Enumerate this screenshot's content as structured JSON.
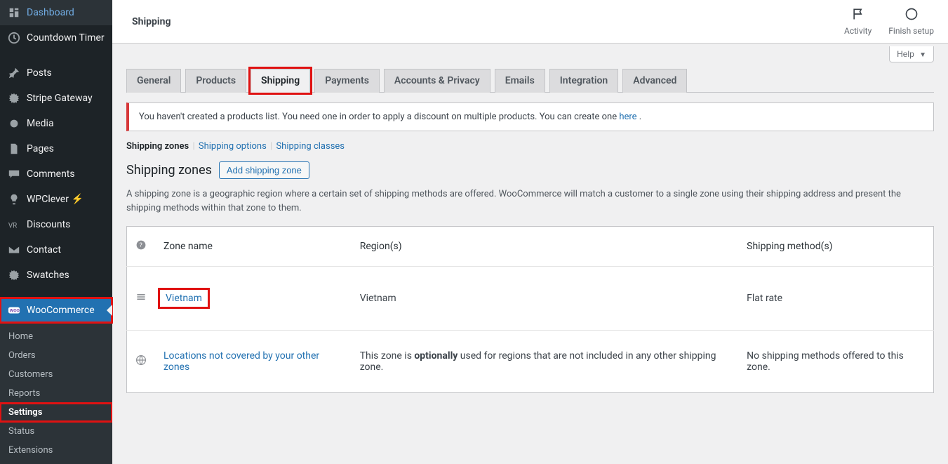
{
  "sidebar": {
    "items": [
      {
        "label": "Dashboard",
        "icon": "dashboard-icon"
      },
      {
        "label": "Countdown Timer",
        "icon": "clock-icon"
      },
      {
        "label": "Posts",
        "icon": "pin-icon"
      },
      {
        "label": "Stripe Gateway",
        "icon": "gear-icon"
      },
      {
        "label": "Media",
        "icon": "media-icon"
      },
      {
        "label": "Pages",
        "icon": "pages-icon"
      },
      {
        "label": "Comments",
        "icon": "comment-icon"
      },
      {
        "label": "WPClever ⚡",
        "icon": "bulb-icon"
      },
      {
        "label": "Discounts",
        "icon": "discount-icon"
      },
      {
        "label": "Contact",
        "icon": "mail-icon"
      },
      {
        "label": "Swatches",
        "icon": "gear-icon"
      },
      {
        "label": "WooCommerce",
        "icon": "woo-icon"
      }
    ],
    "submenu": [
      {
        "label": "Home"
      },
      {
        "label": "Orders"
      },
      {
        "label": "Customers"
      },
      {
        "label": "Reports"
      },
      {
        "label": "Settings",
        "active": true
      },
      {
        "label": "Status"
      },
      {
        "label": "Extensions"
      }
    ]
  },
  "topbar": {
    "title": "Shipping",
    "activity": "Activity",
    "finish_setup": "Finish setup"
  },
  "help_label": "Help",
  "tabs": [
    {
      "label": "General"
    },
    {
      "label": "Products"
    },
    {
      "label": "Shipping",
      "active": true,
      "highlighted": true
    },
    {
      "label": "Payments"
    },
    {
      "label": "Accounts & Privacy"
    },
    {
      "label": "Emails"
    },
    {
      "label": "Integration"
    },
    {
      "label": "Advanced"
    }
  ],
  "notice": {
    "text_before": "You haven't created a products list. You need one in order to apply a discount on multiple products. You can create one ",
    "link_text": "here",
    "text_after": " ."
  },
  "subnav": {
    "current": "Shipping zones",
    "options": "Shipping options",
    "classes": "Shipping classes"
  },
  "heading": "Shipping zones",
  "add_zone_label": "Add shipping zone",
  "description": "A shipping zone is a geographic region where a certain set of shipping methods are offered. WooCommerce will match a customer to a single zone using their shipping address and present the shipping methods within that zone to them.",
  "table": {
    "headers": {
      "zone": "Zone name",
      "region": "Region(s)",
      "method": "Shipping method(s)"
    },
    "rows": [
      {
        "zone": "Vietnam",
        "region": "Vietnam",
        "method": "Flat rate",
        "highlighted": true
      }
    ],
    "footer": {
      "zone": "Locations not covered by your other zones",
      "region_before": "This zone is ",
      "region_strong": "optionally",
      "region_after": " used for regions that are not included in any other shipping zone.",
      "method": "No shipping methods offered to this zone."
    }
  }
}
